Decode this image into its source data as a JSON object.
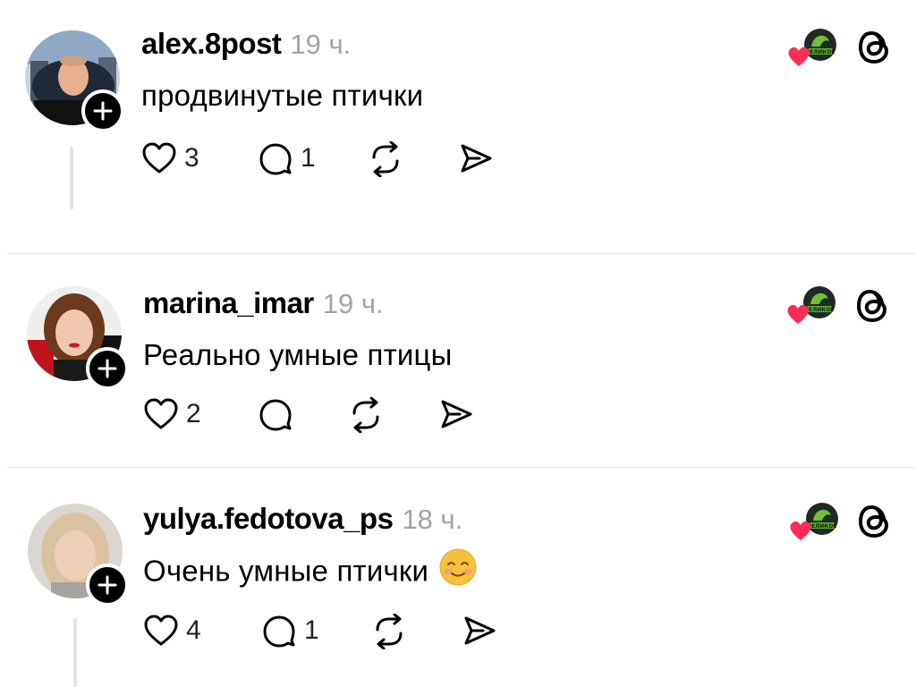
{
  "posts": [
    {
      "username": "alex.8post",
      "time": "19 ч.",
      "text": "продвинутые птички",
      "emoji": "",
      "likes": "3",
      "replies": "1"
    },
    {
      "username": "marina_imar",
      "time": "19 ч.",
      "text": "Реально умные птицы",
      "emoji": "",
      "likes": "2",
      "replies": ""
    },
    {
      "username": "yulya.fedotova_ps",
      "time": "18 ч.",
      "text": "Очень умные птички",
      "emoji": "smiling-face-emoji",
      "likes": "4",
      "replies": "1"
    }
  ],
  "badge": {
    "text": "ВЕЛИКОЕ",
    "icon": "liked-by-author-badge"
  },
  "colors": {
    "heart": "#ff2d55",
    "muted": "#a3a3a3",
    "line": "#e3e3e3"
  }
}
